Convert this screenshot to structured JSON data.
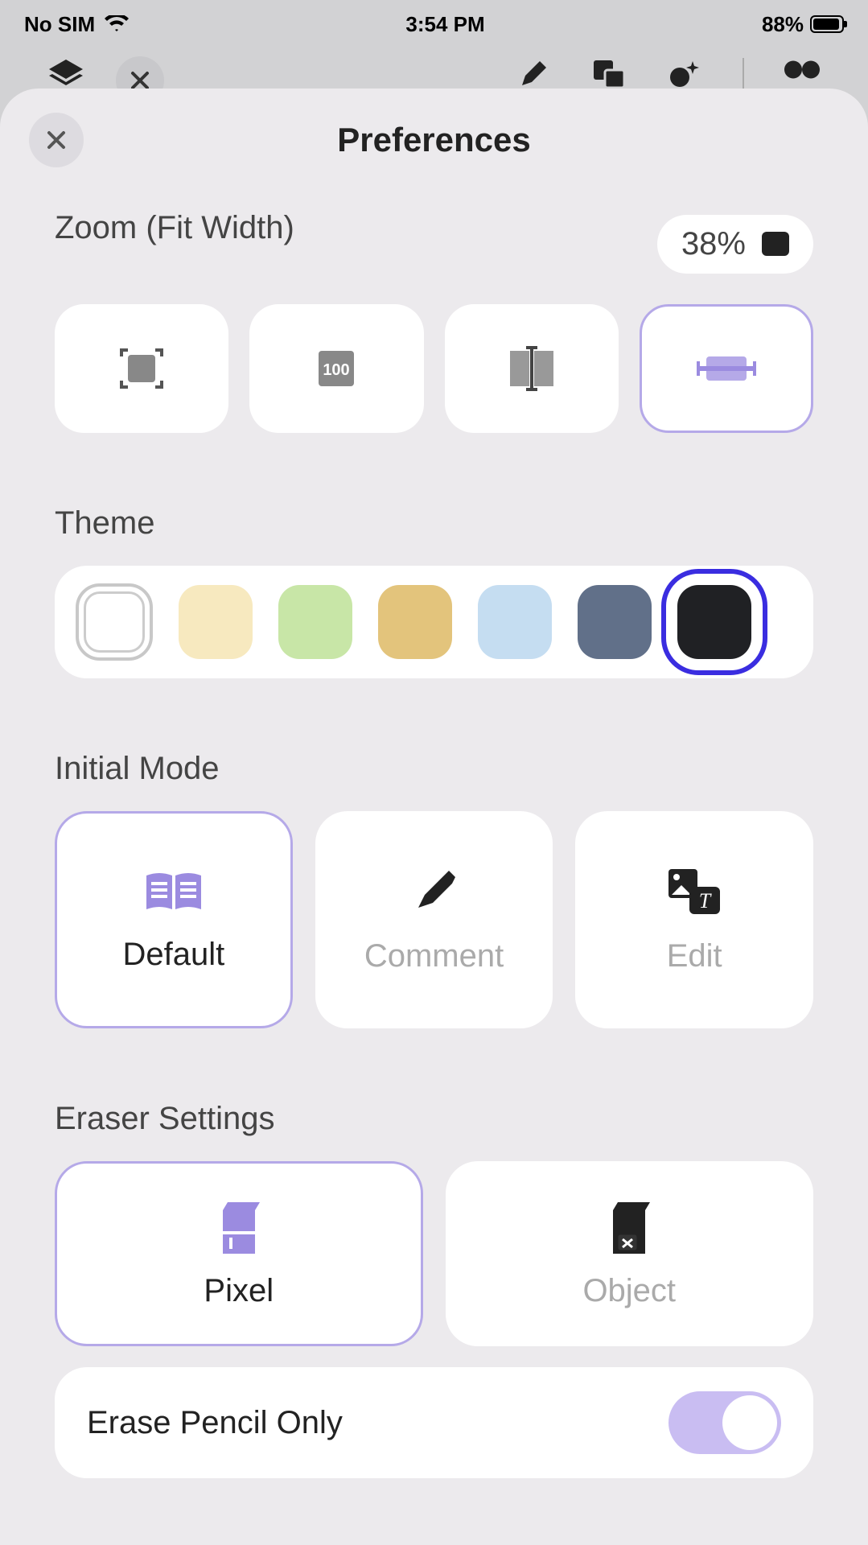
{
  "status": {
    "carrier": "No SIM",
    "time": "3:54 PM",
    "battery": "88%"
  },
  "sheet": {
    "title": "Preferences"
  },
  "zoom": {
    "label": "Zoom (Fit Width)",
    "value": "38%"
  },
  "sections": {
    "theme": "Theme",
    "initial_mode": "Initial Mode",
    "eraser": "Eraser Settings"
  },
  "theme_colors": [
    "#ffffff",
    "#f7e9bf",
    "#c8e6a7",
    "#e3c47c",
    "#c5ddf1",
    "#617089",
    "#202124"
  ],
  "theme_highlighted_index": 6,
  "theme_selected_index": 0,
  "modes": {
    "default": "Default",
    "comment": "Comment",
    "edit": "Edit",
    "selected": "default"
  },
  "eraser": {
    "pixel": "Pixel",
    "object": "Object",
    "selected": "pixel"
  },
  "toggle": {
    "label": "Erase Pencil Only",
    "on": true
  }
}
